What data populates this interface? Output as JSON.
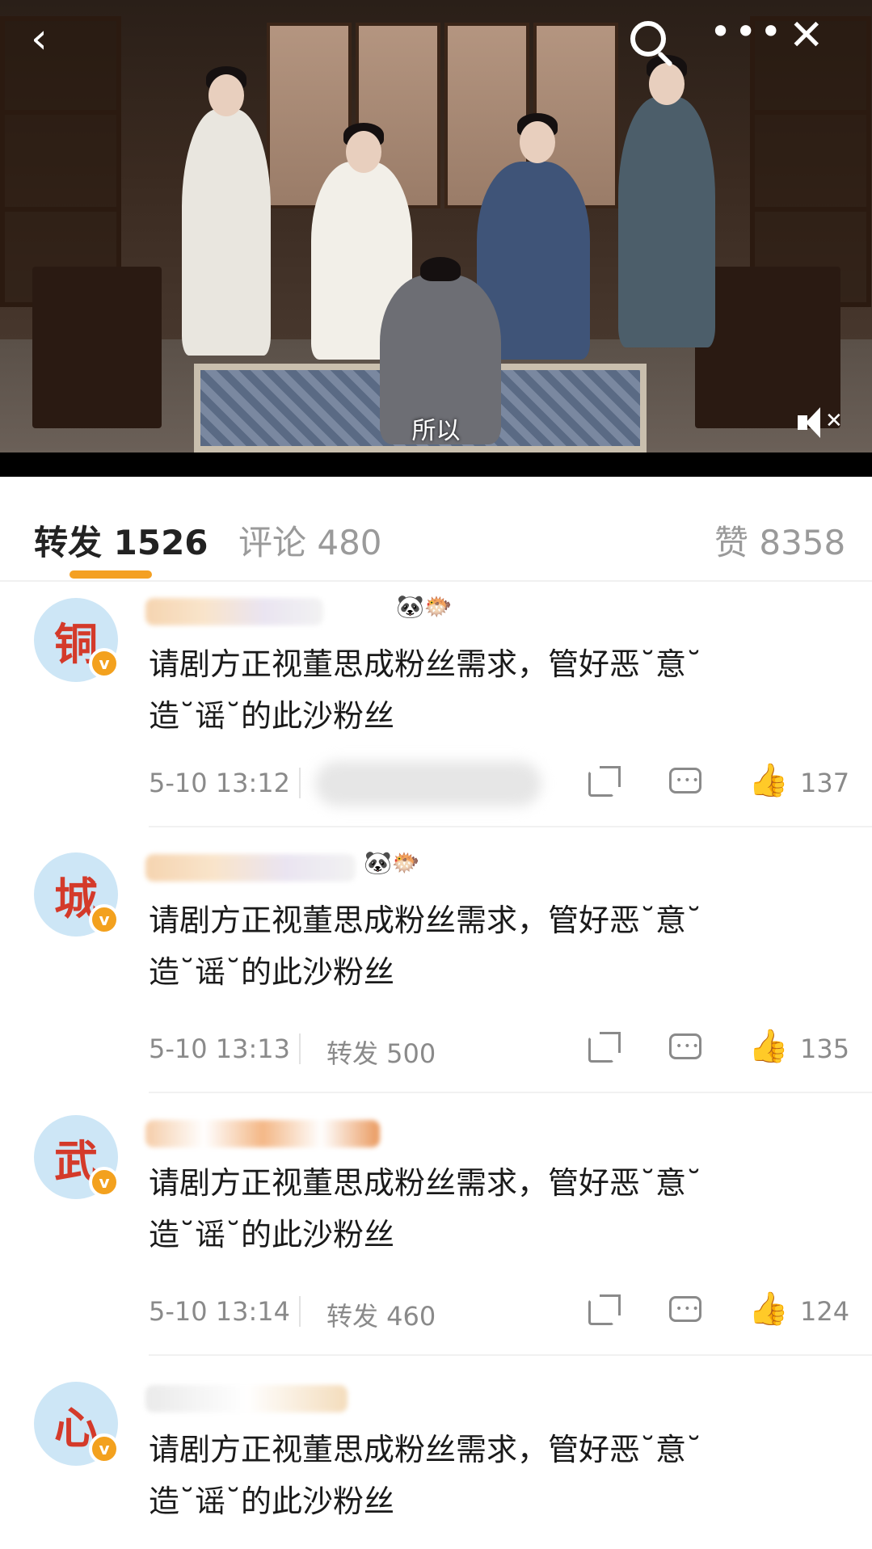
{
  "video": {
    "subtitle": "所以",
    "icons": [
      "back-icon",
      "search-icon",
      "more-icon",
      "close-icon",
      "mute-icon"
    ],
    "back_glyph": "‹",
    "more_glyph": "•••",
    "close_glyph": "✕"
  },
  "tabs": {
    "forward": "转发 1526",
    "comments": "评论 480",
    "likes": "赞 8358"
  },
  "colors": {
    "accent": "#f4a022",
    "avatar_bg": "#cde6f6",
    "avatar_text": "#d43a2a",
    "meta_text": "#8a8a8a"
  },
  "comments": [
    {
      "avatar_char": "铜",
      "badge": "v",
      "emojis": "🐼🐡",
      "line1": "请剧方正视董思成粉丝需求，管好恶˘意˘",
      "line2": "造˘谣˘的此沙粉丝",
      "time": "5-10 13:12",
      "forward": "",
      "likes": "137"
    },
    {
      "avatar_char": "城",
      "badge": "v",
      "emojis": "🐼🐡",
      "line1": "请剧方正视董思成粉丝需求，管好恶˘意˘",
      "line2": "造˘谣˘的此沙粉丝",
      "time": "5-10 13:13",
      "forward": "转发 500",
      "likes": "135"
    },
    {
      "avatar_char": "武",
      "badge": "v",
      "emojis": "",
      "line1": "请剧方正视董思成粉丝需求，管好恶˘意˘",
      "line2": "造˘谣˘的此沙粉丝",
      "time": "5-10 13:14",
      "forward": "转发 460",
      "likes": "124"
    },
    {
      "avatar_char": "心",
      "badge": "v",
      "emojis": "",
      "line1": "请剧方正视董思成粉丝需求，管好恶˘意˘",
      "line2": "造˘谣˘的此沙粉丝",
      "time": "",
      "forward": "",
      "likes": ""
    }
  ]
}
